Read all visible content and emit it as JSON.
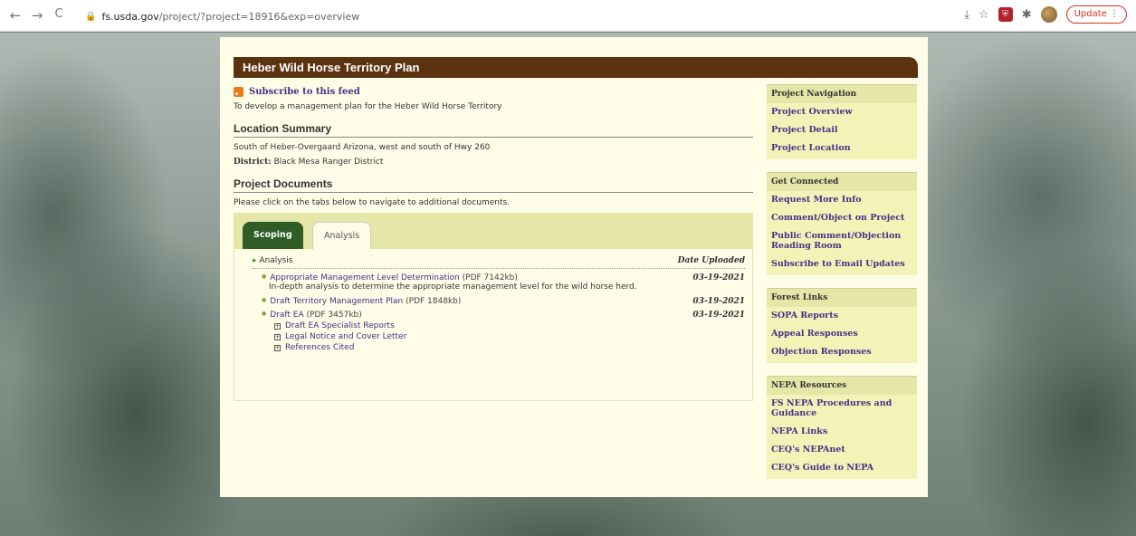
{
  "browser": {
    "back": "←",
    "forward": "→",
    "reload": "C",
    "url_host": "fs.usda.gov",
    "url_path": "/project/?project=18916&exp=overview",
    "update_label": "Update",
    "menu": "⋮"
  },
  "project": {
    "title": "Heber Wild Horse Territory Plan",
    "subscribe_label": "Subscribe to this feed",
    "description": "To develop a management plan for the Heber Wild Horse Territory",
    "location_heading": "Location Summary",
    "location_text": "South of Heber-Overgaard Arizona, west and south of Hwy 260",
    "district_label": "District:",
    "district_value": "Black Mesa Ranger District",
    "documents_heading": "Project Documents",
    "documents_note": "Please click on the tabs below to navigate to additional documents."
  },
  "tabs": [
    {
      "label": "Scoping",
      "active": false
    },
    {
      "label": "Analysis",
      "active": true
    }
  ],
  "docs": {
    "section": "Analysis",
    "date_header": "Date Uploaded",
    "items": [
      {
        "title": "Appropriate Management Level Determination",
        "size": "(PDF 7142kb)",
        "date": "03-19-2021",
        "description": "In-depth analysis to determine the appropriate management level for the wild horse herd."
      },
      {
        "title": "Draft Territory Management Plan",
        "size": "(PDF 1848kb)",
        "date": "03-19-2021"
      },
      {
        "title": "Draft EA",
        "size": "(PDF 3457kb)",
        "date": "03-19-2021"
      }
    ],
    "subitems": [
      "Draft EA Specialist Reports",
      "Legal Notice and Cover Letter",
      "References Cited"
    ]
  },
  "sidebar": {
    "nav": {
      "heading": "Project Navigation",
      "links": [
        "Project Overview",
        "Project Detail",
        "Project Location"
      ]
    },
    "connect": {
      "heading": "Get Connected",
      "links": [
        "Request More Info",
        "Comment/Object on Project",
        "Public Comment/Objection Reading Room",
        "Subscribe to Email Updates"
      ]
    },
    "forest": {
      "heading": "Forest Links",
      "links": [
        "SOPA Reports",
        "Appeal Responses",
        "Objection Responses"
      ]
    },
    "nepa": {
      "heading": "NEPA Resources",
      "links": [
        "FS NEPA Procedures and Guidance",
        "NEPA Links",
        "CEQ's NEPAnet",
        "CEQ's Guide to NEPA"
      ]
    }
  },
  "colors": {
    "title_bar": "#5c3310",
    "link": "#4a2f86",
    "page_bg": "#fdfde8",
    "sidebar_bg": "#f3f3b8",
    "active_tab": "#2f5d25"
  }
}
